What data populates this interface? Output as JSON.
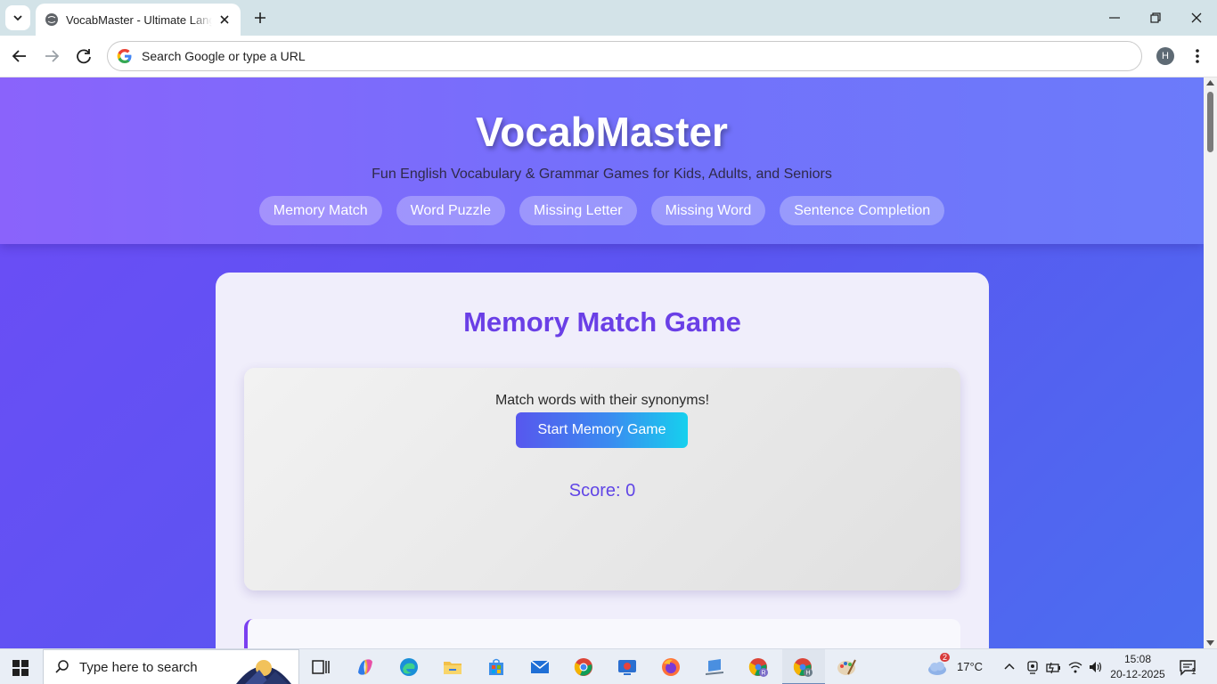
{
  "browser": {
    "tab_title": "VocabMaster - Ultimate Language",
    "omnibox_placeholder": "Search Google or type a URL",
    "profile_initial": "H"
  },
  "site": {
    "brand": "VocabMaster",
    "tagline": "Fun English Vocabulary & Grammar Games for Kids, Adults, and Seniors",
    "nav": [
      {
        "label": "Memory Match"
      },
      {
        "label": "Word Puzzle"
      },
      {
        "label": "Missing Letter"
      },
      {
        "label": "Missing Word"
      },
      {
        "label": "Sentence Completion"
      }
    ]
  },
  "game": {
    "title": "Memory Match Game",
    "instructions": "Match words with their synonyms!",
    "start_label": "Start Memory Game",
    "score_label": "Score: ",
    "score_value": "0"
  },
  "taskbar": {
    "search_placeholder": "Type here to search",
    "weather_temp": "17°C",
    "weather_badge": "2",
    "time": "15:08",
    "date": "20-12-2025",
    "notification_count": "1"
  },
  "colors": {
    "accent_purple": "#6a3fe6",
    "header_gradient_start": "#8a63fb",
    "button_gradient_end": "#16d0ee"
  }
}
